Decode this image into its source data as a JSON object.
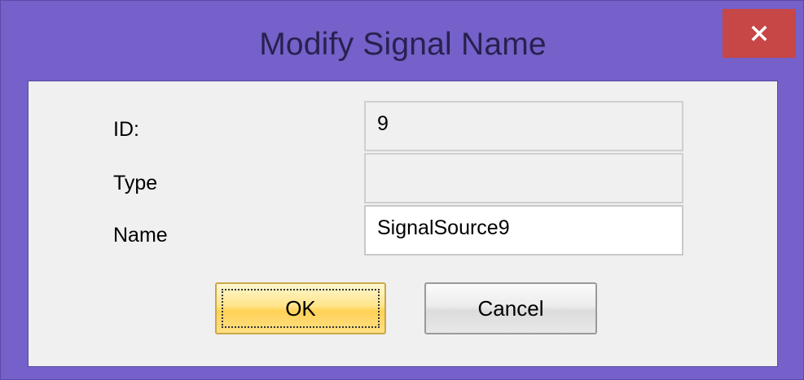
{
  "window": {
    "title": "Modify Signal Name",
    "close_icon": "close-icon",
    "colors": {
      "frame": "#7561c9",
      "close_button": "#c74646",
      "client": "#f0f0f0",
      "ok_button": "#ffdf84"
    }
  },
  "form": {
    "id_label": "ID:",
    "id_value": "9",
    "type_label": "Type",
    "type_value": "",
    "name_label": "Name",
    "name_value": "SignalSource9"
  },
  "buttons": {
    "ok_label": "OK",
    "cancel_label": "Cancel"
  }
}
